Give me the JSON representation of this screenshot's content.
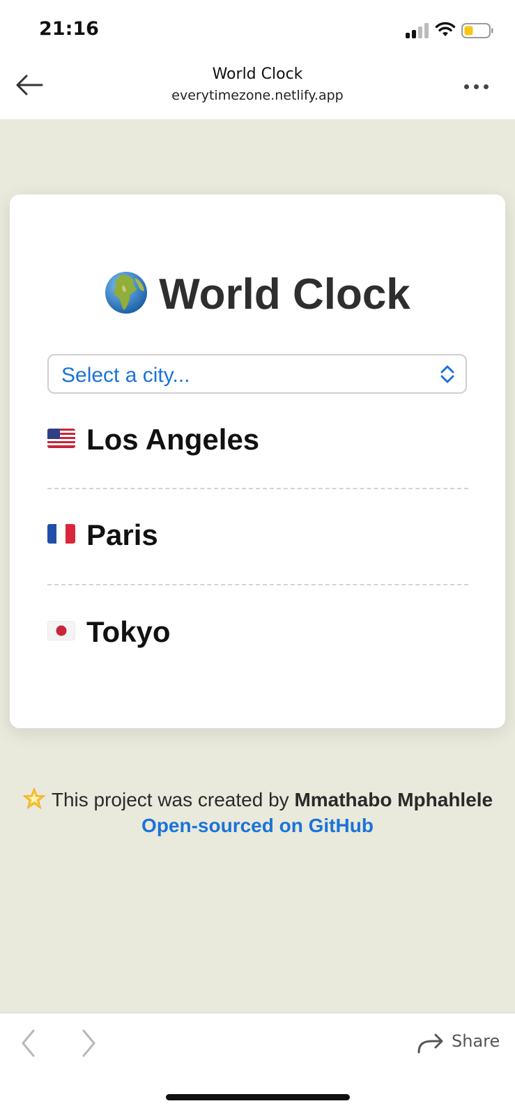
{
  "status_bar": {
    "time": "21:16"
  },
  "nav": {
    "title": "World Clock",
    "url": "everytimezone.netlify.app"
  },
  "card": {
    "title": "World Clock",
    "select": {
      "placeholder": "Select a city..."
    },
    "cities": [
      {
        "name": "Los Angeles",
        "flag": "us-flag-icon"
      },
      {
        "name": "Paris",
        "flag": "fr-flag-icon"
      },
      {
        "name": "Tokyo",
        "flag": "jp-flag-icon"
      }
    ]
  },
  "footer": {
    "created_prefix": "This project was created by",
    "author": "Mmathabo Mphahlele",
    "link": "Open-sourced on GitHub"
  },
  "toolbar": {
    "share_label": "Share"
  },
  "colors": {
    "page_background": "#e9e9dc",
    "link_blue": "#1a73d9",
    "battery_yellow": "#f5c518"
  }
}
